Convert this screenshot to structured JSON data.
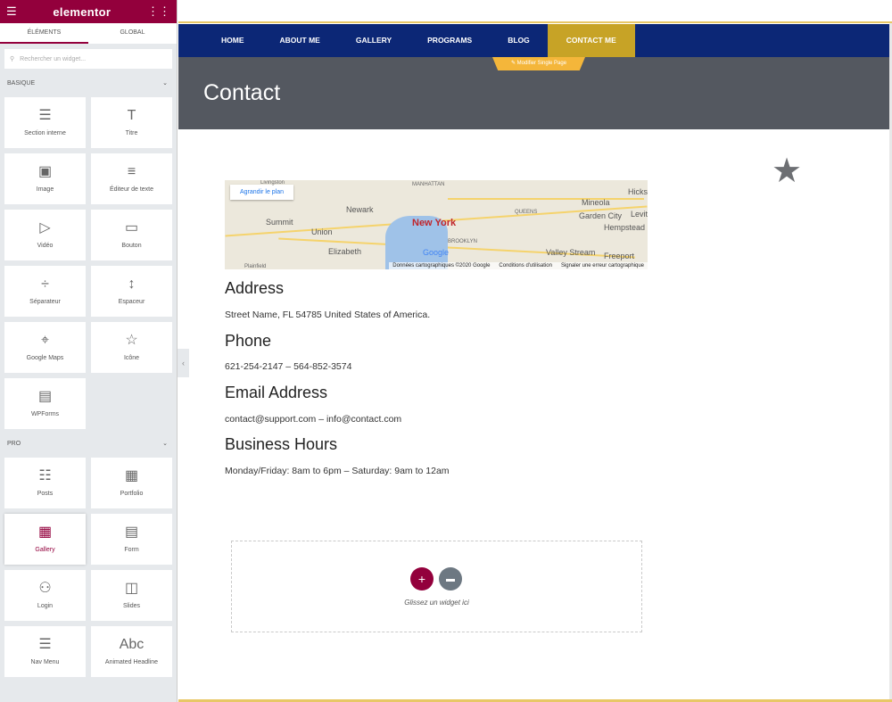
{
  "panel": {
    "logo": "elementor",
    "tabs": [
      "ÉLÉMENTS",
      "GLOBAL"
    ],
    "search_placeholder": "Rechercher un widget...",
    "categories": [
      {
        "label": "BASIQUE",
        "widgets": [
          {
            "label": "Section interne",
            "icon": "columns-icon"
          },
          {
            "label": "Titre",
            "icon": "heading-icon"
          },
          {
            "label": "Image",
            "icon": "image-icon"
          },
          {
            "label": "Éditeur de texte",
            "icon": "text-editor-icon"
          },
          {
            "label": "Vidéo",
            "icon": "video-icon"
          },
          {
            "label": "Bouton",
            "icon": "button-icon"
          },
          {
            "label": "Séparateur",
            "icon": "divider-icon"
          },
          {
            "label": "Espaceur",
            "icon": "spacer-icon"
          },
          {
            "label": "Google Maps",
            "icon": "map-icon"
          },
          {
            "label": "Icône",
            "icon": "star-icon"
          },
          {
            "label": "WPForms",
            "icon": "form-icon"
          }
        ]
      },
      {
        "label": "PRO",
        "widgets": [
          {
            "label": "Posts",
            "icon": "posts-icon"
          },
          {
            "label": "Portfolio",
            "icon": "portfolio-icon"
          },
          {
            "label": "Gallery",
            "icon": "gallery-icon",
            "selected": true
          },
          {
            "label": "Form",
            "icon": "form-icon"
          },
          {
            "label": "Login",
            "icon": "login-icon"
          },
          {
            "label": "Slides",
            "icon": "slides-icon"
          },
          {
            "label": "Nav Menu",
            "icon": "nav-menu-icon"
          },
          {
            "label": "Animated Headline",
            "icon": "animated-headline-icon"
          }
        ]
      }
    ]
  },
  "nav": {
    "items": [
      "HOME",
      "ABOUT ME",
      "GALLERY",
      "PROGRAMS",
      "BLOG",
      "CONTACT ME"
    ],
    "active": "CONTACT ME"
  },
  "edit_badge": "✎ Modifier Single Page",
  "hero": {
    "title": "Contact"
  },
  "map": {
    "enlarge": "Agrandir le plan",
    "labels": [
      "Livingston",
      "MANHATTAN",
      "Newark",
      "Summit",
      "Union",
      "Elizabeth",
      "Plainfield",
      "New York",
      "QUEENS",
      "BROOKLYN",
      "Mineola",
      "Garden City",
      "Hempstead",
      "Valley Stream",
      "Freeport",
      "Hicksville",
      "Levittown"
    ],
    "attribution": [
      "Données cartographiques ©2020 Google",
      "Conditions d'utilisation",
      "Signaler une erreur cartographique"
    ],
    "google": "Google"
  },
  "sections": [
    {
      "heading": "Address",
      "text": "Street Name, FL 54785 United States of America."
    },
    {
      "heading": "Phone",
      "text": "621-254-2147 – 564-852-3574"
    },
    {
      "heading": "Email Address",
      "text": "contact@support.com – info@contact.com"
    },
    {
      "heading": "Business Hours",
      "text": "Monday/Friday: 8am to 6pm – Saturday: 9am to 12am"
    }
  ],
  "dropzone": {
    "text": "Glissez un widget ici"
  },
  "colors": {
    "brand": "#93003c",
    "nav": "#0c2776",
    "nav_active": "#c7a326",
    "hero": "#545860"
  }
}
